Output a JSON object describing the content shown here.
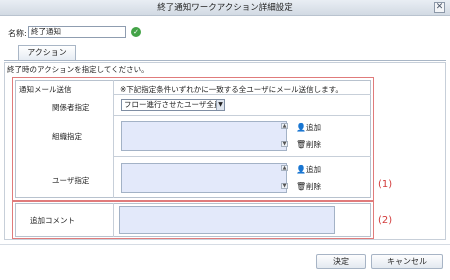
{
  "dialog": {
    "title": "終了通知ワークアクション詳細設定",
    "close_symbol": "✕",
    "name_label": "名称:",
    "name_value": "終了通知",
    "tab_label": "アクション",
    "description": "終了時のアクションを指定してください。"
  },
  "form": {
    "mail_section_label": "通知メール送信",
    "mail_note": "※下記指定条件いずれかに一致する全ユーザにメール送信します。",
    "related_label": "関係者指定",
    "related_selected": "フロー進行させたユーザ全員",
    "org_label": "組織指定",
    "user_label": "ユーザ指定",
    "add_label": "追加",
    "delete_label": "削除",
    "comment_label": "追加コメント"
  },
  "annotations": {
    "marker1": "(1)",
    "marker2": "(2)"
  },
  "footer": {
    "ok_label": "決定",
    "cancel_label": "キャンセル"
  },
  "colors": {
    "highlight_border": "#e07b7b",
    "highlight_text": "#d23a3a",
    "listbox_fill": "#e3e9fa"
  },
  "icons": {
    "confirm": "check-circle-icon",
    "add": "user-add-icon",
    "delete": "trash-icon"
  }
}
